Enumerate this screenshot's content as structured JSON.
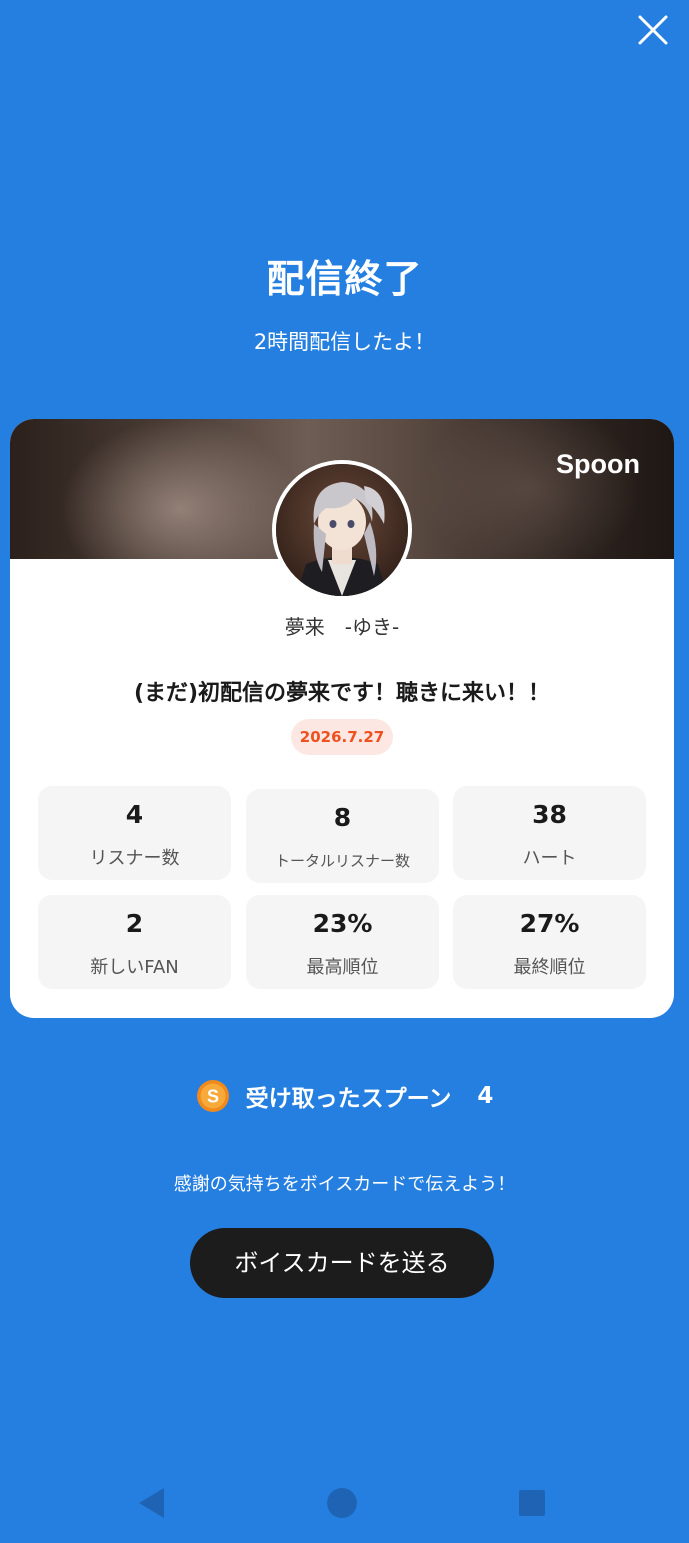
{
  "header": {
    "close_icon": "close-icon"
  },
  "summary": {
    "title": "配信終了",
    "subtitle": "2時間配信したよ！"
  },
  "card": {
    "brand": "Spoon",
    "username": "夢来　-ゆき-",
    "live_title": "(まだ)初配信の夢来です！聴きに来い！！",
    "date": "2026.7.27",
    "stats": [
      {
        "value": "4",
        "label": "リスナー数"
      },
      {
        "value": "8",
        "label": "トータルリスナー数"
      },
      {
        "value": "38",
        "label": "ハート"
      },
      {
        "value": "2",
        "label": "新しいFAN"
      },
      {
        "value": "23%",
        "label": "最高順位"
      },
      {
        "value": "27%",
        "label": "最終順位"
      }
    ]
  },
  "spoons": {
    "label": "受け取ったスプーン",
    "count": "4",
    "coin_letter": "S"
  },
  "cta": {
    "message": "感謝の気持ちをボイスカードで伝えよう！",
    "button_label": "ボイスカードを送る"
  },
  "system_nav": {
    "back_icon": "back-triangle-icon",
    "home_icon": "home-circle-icon",
    "recents_icon": "recents-square-icon"
  },
  "colors": {
    "background": "#247fe0",
    "date_badge_text": "#f0501e",
    "button_background": "#1c1c1c"
  }
}
